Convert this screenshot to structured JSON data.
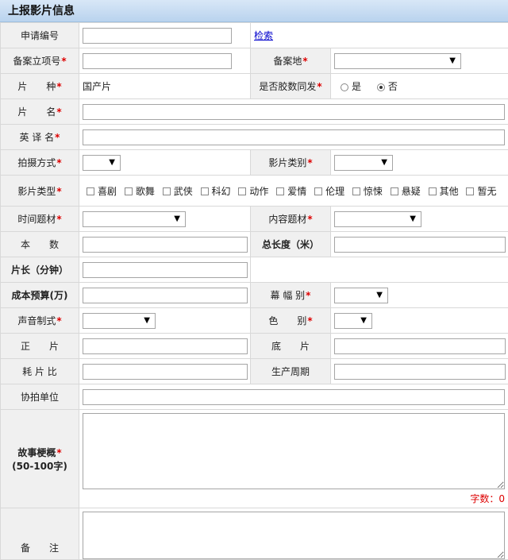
{
  "header": {
    "title": "上报影片信息"
  },
  "form": {
    "app_no": {
      "label": "申请编号",
      "value": "",
      "search_link": "检索"
    },
    "record_no": {
      "label": "备案立项号",
      "value": ""
    },
    "record_place": {
      "label": "备案地",
      "selected": ""
    },
    "film_kind": {
      "label": "片　　种",
      "value": "国产片"
    },
    "film_copy": {
      "label": "是否胶数同发",
      "options": [
        "是",
        "否"
      ],
      "selected": "否"
    },
    "film_name": {
      "label": "片　　名",
      "value": ""
    },
    "english_name": {
      "label": "英 译 名",
      "value": ""
    },
    "shoot_mode": {
      "label": "拍摄方式",
      "selected": ""
    },
    "film_category": {
      "label": "影片类别",
      "selected": ""
    },
    "film_type": {
      "label": "影片类型",
      "options": [
        "喜剧",
        "歌舞",
        "武侠",
        "科幻",
        "动作",
        "爱情",
        "伦理",
        "惊悚",
        "悬疑",
        "其他",
        "暂无"
      ]
    },
    "time_theme": {
      "label": "时间题材",
      "selected": ""
    },
    "content_theme": {
      "label": "内容题材",
      "selected": ""
    },
    "reels": {
      "label": "本　　数",
      "value": ""
    },
    "total_length": {
      "label": "总长度（米）",
      "value": ""
    },
    "duration": {
      "label": "片长（分钟）",
      "value": ""
    },
    "budget": {
      "label": "成本预算(万)",
      "value": ""
    },
    "screen_format": {
      "label": "幕 幅 别",
      "selected": ""
    },
    "sound_format": {
      "label": "声音制式",
      "selected": ""
    },
    "color_type": {
      "label": "色　　别",
      "selected": ""
    },
    "positive_film": {
      "label": "正　　片",
      "value": ""
    },
    "negative_film": {
      "label": "底　　片",
      "value": ""
    },
    "film_ratio": {
      "label": "耗 片 比",
      "value": ""
    },
    "production_cycle": {
      "label": "生产周期",
      "value": ""
    },
    "co_producer": {
      "label": "协拍单位",
      "value": ""
    },
    "synopsis": {
      "label": "故事梗概",
      "hint": "(50-100字)",
      "value": "",
      "count_text": "字数：0"
    },
    "remarks": {
      "label": "备　　注",
      "value": ""
    }
  },
  "required_mark": "*"
}
